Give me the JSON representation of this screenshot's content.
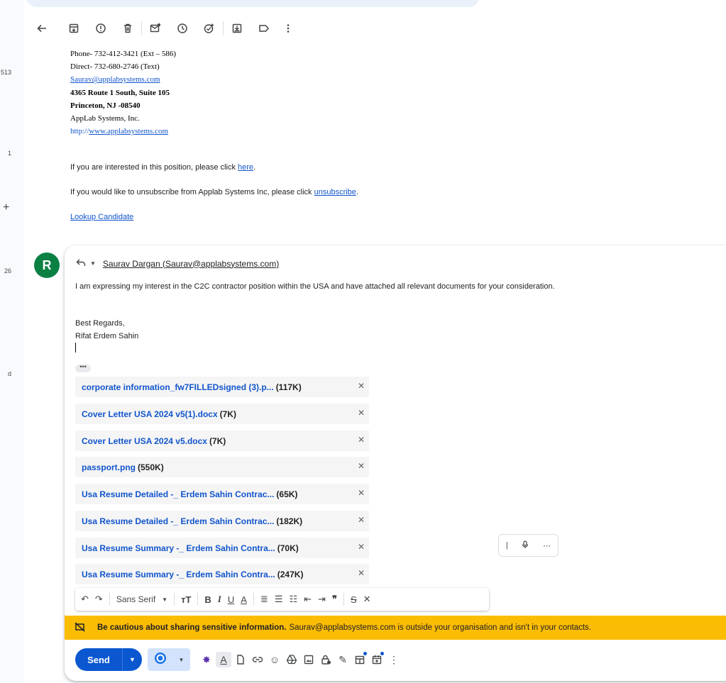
{
  "rail": {
    "counts": [
      "513",
      "1",
      "26",
      "d"
    ],
    "plus_icon": "plus-icon"
  },
  "toolbar": {
    "icons": [
      "back-arrow-icon",
      "archive-icon",
      "report-spam-icon",
      "delete-icon",
      "mark-unread-icon",
      "snooze-icon",
      "add-to-tasks-icon",
      "move-to-icon",
      "label-icon",
      "more-vert-icon"
    ]
  },
  "signature": {
    "phone": "Phone- 732-412-3421 (Ext – 586)",
    "direct": "Direct- 732-680-2746  (Text)",
    "email": "Saurav@applabsystems.com",
    "address1": "4365 Route 1 South, Suite 105",
    "address2": "Princeton, NJ -08540",
    "company": "AppLab Systems, Inc.",
    "website_prefix": "http://",
    "website": "www.applabsystems.com"
  },
  "message": {
    "interest_text": "If you are interested in this position, please click ",
    "interest_link": "here",
    "interest_end": ".",
    "unsub_text": "If you would like to unsubscribe from Applab Systems Inc, please click ",
    "unsub_link": "unsubscribe",
    "unsub_end": ".",
    "lookup": "Lookup Candidate"
  },
  "reply": {
    "avatar_letter": "R",
    "recipient": "Saurav Dargan (Saurav@applabsystems.com)",
    "body": "I am expressing my interest in the C2C contractor position within the USA and have attached all relevant documents for your consideration.",
    "closing": "Best Regards,",
    "name": "Rifat Erdem Sahin",
    "dots": "•••"
  },
  "attachments": [
    {
      "name": "corporate information_fw7FILLEDsigned (3).p...",
      "size": "(117K)"
    },
    {
      "name": "Cover Letter USA 2024 v5(1).docx",
      "size": "(7K)"
    },
    {
      "name": "Cover Letter USA 2024 v5.docx",
      "size": "(7K)"
    },
    {
      "name": "passport.png",
      "size": "(550K)"
    },
    {
      "name": "Usa Resume Detailed -_ Erdem Sahin Contrac...",
      "size": "(65K)"
    },
    {
      "name": "Usa Resume Detailed -_ Erdem Sahin Contrac...",
      "size": "(182K)"
    },
    {
      "name": "Usa Resume Summary -_ Erdem Sahin Contra...",
      "size": "(70K)"
    },
    {
      "name": "Usa Resume Summary -_ Erdem Sahin Contra...",
      "size": "(247K)"
    }
  ],
  "formatting": {
    "font": "Sans Serif"
  },
  "warning": {
    "bold": "Be cautious about sharing sensitive information.",
    "rest": "Saurav@applabsystems.com is outside your organisation and isn't in your contacts."
  },
  "compose": {
    "send_label": "Send"
  },
  "colors": {
    "accent": "#0b57d0",
    "warning": "#fbbc04",
    "link": "#1155cc",
    "avatar": "#0b8043"
  }
}
